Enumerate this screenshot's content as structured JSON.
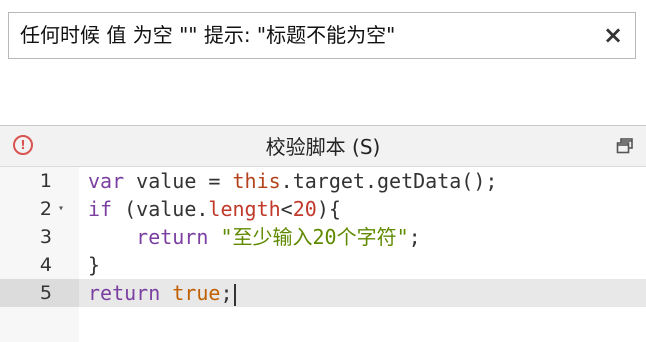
{
  "hint": {
    "text": "任何时候 值 为空 \"\" 提示: \"标题不能为空\"",
    "close_label": "×"
  },
  "panel": {
    "title": "校验脚本 (S)",
    "error_icon_label": "!",
    "error_icon": "error-circle-icon",
    "restore_icon": "restore-window-icon"
  },
  "editor": {
    "active_line": 5,
    "lines": [
      {
        "number": "1",
        "tokens": [
          {
            "t": "var",
            "c": "kw"
          },
          {
            "t": " value = ",
            "c": ""
          },
          {
            "t": "this",
            "c": "kw2"
          },
          {
            "t": ".target.getData();",
            "c": ""
          }
        ]
      },
      {
        "number": "2",
        "fold": "▾",
        "tokens": [
          {
            "t": "if",
            "c": "kw"
          },
          {
            "t": " (value.",
            "c": ""
          },
          {
            "t": "length",
            "c": "prop"
          },
          {
            "t": "<",
            "c": ""
          },
          {
            "t": "20",
            "c": "num"
          },
          {
            "t": "){",
            "c": ""
          }
        ]
      },
      {
        "number": "3",
        "tokens": [
          {
            "t": "    ",
            "c": ""
          },
          {
            "t": "return",
            "c": "kw"
          },
          {
            "t": " ",
            "c": ""
          },
          {
            "t": "\"至少输入20个字符\"",
            "c": "str"
          },
          {
            "t": ";",
            "c": ""
          }
        ]
      },
      {
        "number": "4",
        "tokens": [
          {
            "t": "}",
            "c": ""
          }
        ]
      },
      {
        "number": "5",
        "tokens": [
          {
            "t": "return",
            "c": "kw"
          },
          {
            "t": " ",
            "c": ""
          },
          {
            "t": "true",
            "c": "bool"
          },
          {
            "t": ";",
            "c": ""
          }
        ]
      }
    ]
  },
  "colors": {
    "keyword": "#7a3fa0",
    "this": "#b3421c",
    "number": "#c0392b",
    "string": "#5f8a00",
    "boolean": "#c06000",
    "error": "#d9534f"
  }
}
